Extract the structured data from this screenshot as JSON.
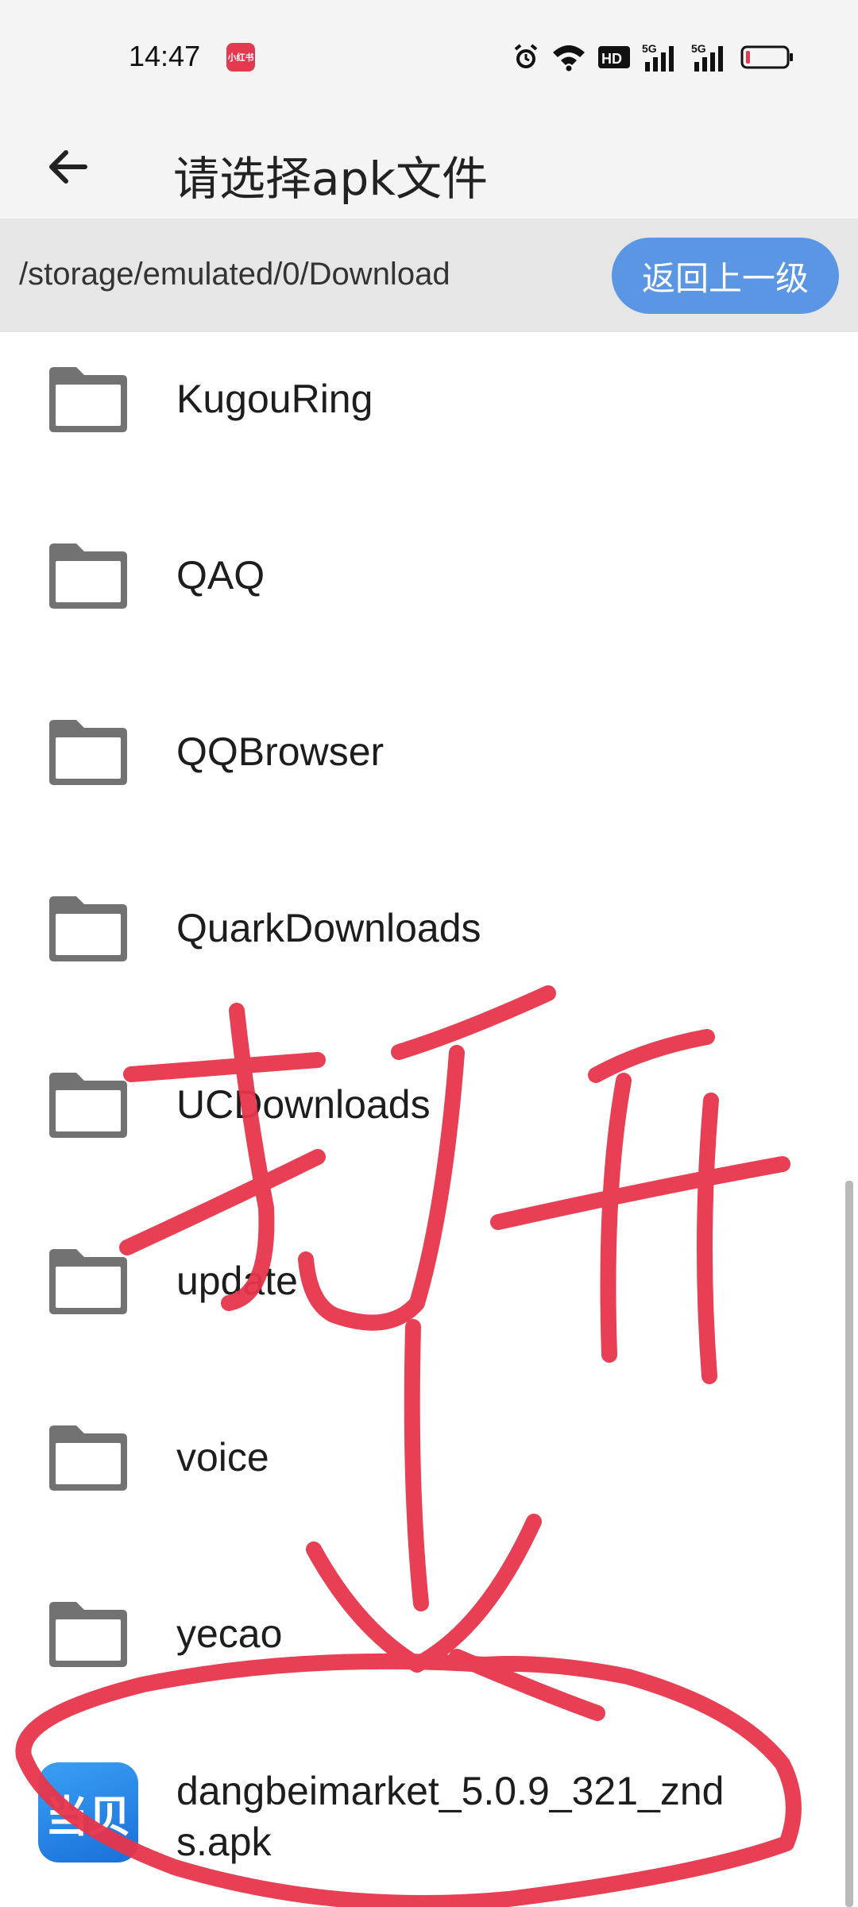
{
  "status_bar": {
    "time": "14:47",
    "app_badge_label": "小红书",
    "icons": [
      "alarm-icon",
      "wifi-icon",
      "hd-icon",
      "signal-5g-icon",
      "signal-5g-icon",
      "battery-low-icon"
    ],
    "hd_label": "HD",
    "network_label_1": "5G",
    "network_label_2": "5G",
    "battery_color": "#e53950"
  },
  "app_bar": {
    "back_icon": "arrow-left-icon",
    "title": "请选择apk文件"
  },
  "path_bar": {
    "path": "/storage/emulated/0/Download",
    "up_button_label": "返回上一级",
    "accent_color": "#5b96e4"
  },
  "files": {
    "folders": [
      {
        "name": "KugouRing"
      },
      {
        "name": "QAQ"
      },
      {
        "name": "QQBrowser"
      },
      {
        "name": "QuarkDownloads"
      },
      {
        "name": "UCDownloads"
      },
      {
        "name": "update"
      },
      {
        "name": "voice"
      },
      {
        "name": "yecao"
      }
    ],
    "apk": {
      "name": "dangbeimarket_5.0.9_321_znds.apk",
      "icon_label": "当贝"
    }
  },
  "annotation": {
    "handwritten_text": "打开",
    "color": "#e8354b"
  }
}
